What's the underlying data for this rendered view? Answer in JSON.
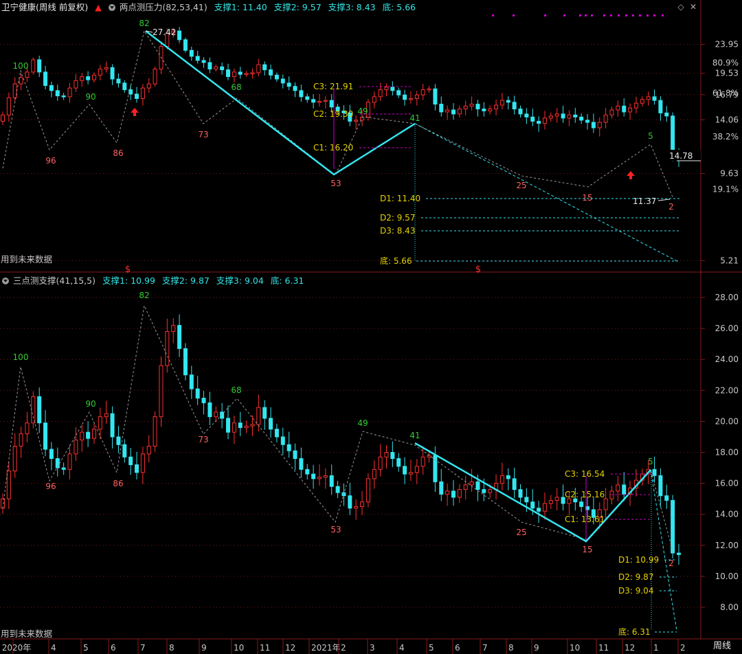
{
  "header1": {
    "stock": "卫宁健康(周线 前复权)",
    "indicator": "两点测压力",
    "params": "(82,53,41)",
    "supports": [
      "支撑1: 11.40",
      "支撑2: 9.57",
      "支撑3: 8.43",
      "底: 5.66"
    ]
  },
  "header2": {
    "indicator": "三点测支撑",
    "params": "(41,15,5)",
    "supports": [
      "支撑1: 10.99",
      "支撑2: 9.87",
      "支撑3: 9.04",
      "底: 6.31"
    ]
  },
  "future_note": "用到未来数据",
  "timeframe": "周线",
  "colors": {
    "up": "#ff3030",
    "down": "#33e6f0",
    "bg": "#000000",
    "grid": "#7a1a1a",
    "accent_yellow": "#e6d200",
    "accent_cyan": "#33e6e6",
    "magenta": "#d000d0"
  },
  "chart_data": [
    {
      "type": "candlestick",
      "name": "两点测压力",
      "y_ticks": [
        "23.95",
        "19.53",
        "16.79",
        "14.06",
        "9.63",
        "5.21"
      ],
      "pct_ticks": [
        "80.9%",
        "61.8%",
        "38.2%",
        "19.1%"
      ],
      "x_ticks": [
        "2020年",
        "4",
        "5",
        "6",
        "7",
        "8",
        "9",
        "10",
        "11",
        "12",
        "2021年",
        "2",
        "3",
        "4",
        "5",
        "6",
        "7",
        "8",
        "9",
        "10",
        "11",
        "12",
        "1",
        "2"
      ],
      "swing_labels": [
        "100",
        "96",
        "90",
        "86",
        "82",
        "73",
        "68",
        "53",
        "49",
        "41",
        "25",
        "15",
        "5",
        "2"
      ],
      "price_marks": [
        "27.42",
        "14.78",
        "11.37"
      ],
      "levels": [
        "C3: 21.91",
        "C2: 19.30",
        "C1: 16.20",
        "D1: 11.40",
        "D2: 9.57",
        "D3: 8.43",
        "底: 5.66"
      ],
      "dollar_marks": [
        "$",
        "$"
      ]
    },
    {
      "type": "candlestick",
      "name": "三点测支撑",
      "y_ticks": [
        "28.00",
        "26.00",
        "24.00",
        "22.00",
        "20.00",
        "18.00",
        "16.00",
        "14.00",
        "12.00",
        "10.00",
        "8.00"
      ],
      "swing_labels": [
        "100",
        "96",
        "90",
        "86",
        "82",
        "73",
        "68",
        "53",
        "49",
        "41",
        "25",
        "15",
        "5",
        "2"
      ],
      "levels": [
        "C3: 16.54",
        "C2: 15.16",
        "C1: 13.61",
        "D1: 10.99",
        "D2: 9.87",
        "D3: 9.04",
        "底: 6.31"
      ]
    }
  ]
}
